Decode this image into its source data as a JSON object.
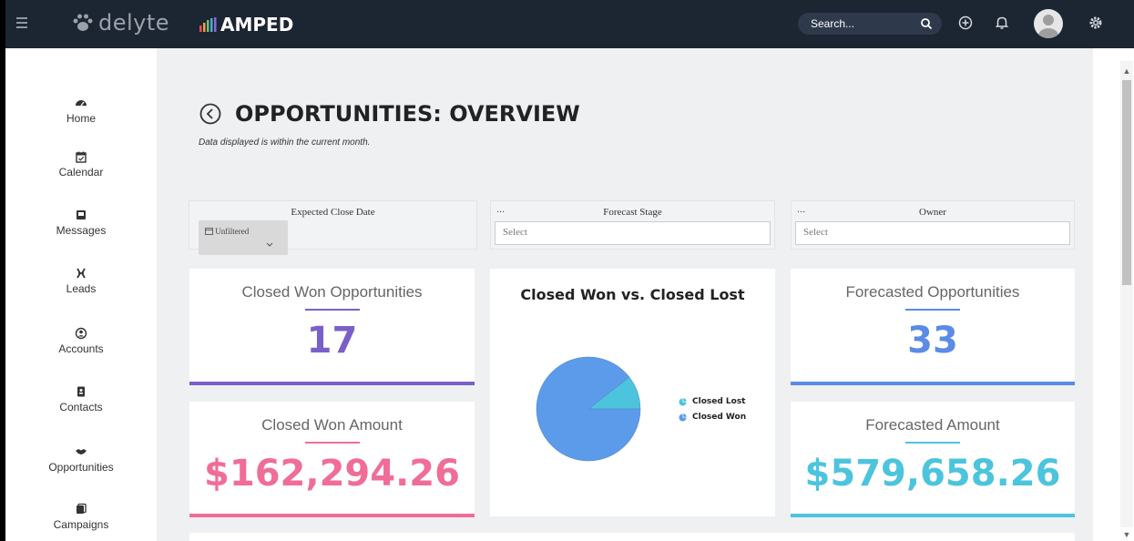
{
  "header": {
    "brand": "delyte",
    "app_name": "AMPED",
    "search_placeholder": "Search..."
  },
  "sidebar": {
    "items": [
      {
        "label": "Home",
        "icon": "dashboard-icon"
      },
      {
        "label": "Calendar",
        "icon": "calendar-icon"
      },
      {
        "label": "Messages",
        "icon": "inbox-icon"
      },
      {
        "label": "Leads",
        "icon": "leads-icon"
      },
      {
        "label": "Accounts",
        "icon": "account-icon"
      },
      {
        "label": "Contacts",
        "icon": "contact-book-icon"
      },
      {
        "label": "Opportunities",
        "icon": "handshake-icon"
      },
      {
        "label": "Campaigns",
        "icon": "campaign-icon"
      }
    ]
  },
  "page": {
    "title": "OPPORTUNITIES: OVERVIEW",
    "subtitle": "Data displayed is within the current month."
  },
  "filters": {
    "close_date": {
      "label": "Expected Close Date",
      "value": "Unfiltered"
    },
    "forecast_stage": {
      "dots": "...",
      "label": "Forecast Stage",
      "placeholder": "Select"
    },
    "owner": {
      "dots": "...",
      "label": "Owner",
      "placeholder": "Select"
    }
  },
  "cards": {
    "closed_won_opps": {
      "title": "Closed Won Opportunities",
      "value": "17",
      "color": "#7b5fc9"
    },
    "closed_won_amount": {
      "title": "Closed Won Amount",
      "value": "$162,294.26",
      "color": "#f06d97"
    },
    "forecasted_opps": {
      "title": "Forecasted Opportunities",
      "value": "33",
      "color": "#5a8be6"
    },
    "forecasted_amount": {
      "title": "Forecasted Amount",
      "value": "$579,658.26",
      "color": "#4cc4dd"
    }
  },
  "chart_data": {
    "type": "pie",
    "title": "Closed Won vs. Closed Lost",
    "series": [
      {
        "name": "Closed Lost",
        "value": 1,
        "color": "#4cc4dd"
      },
      {
        "name": "Closed Won",
        "value": 8.5,
        "color": "#5b9bea"
      }
    ],
    "legend_position": "right"
  }
}
